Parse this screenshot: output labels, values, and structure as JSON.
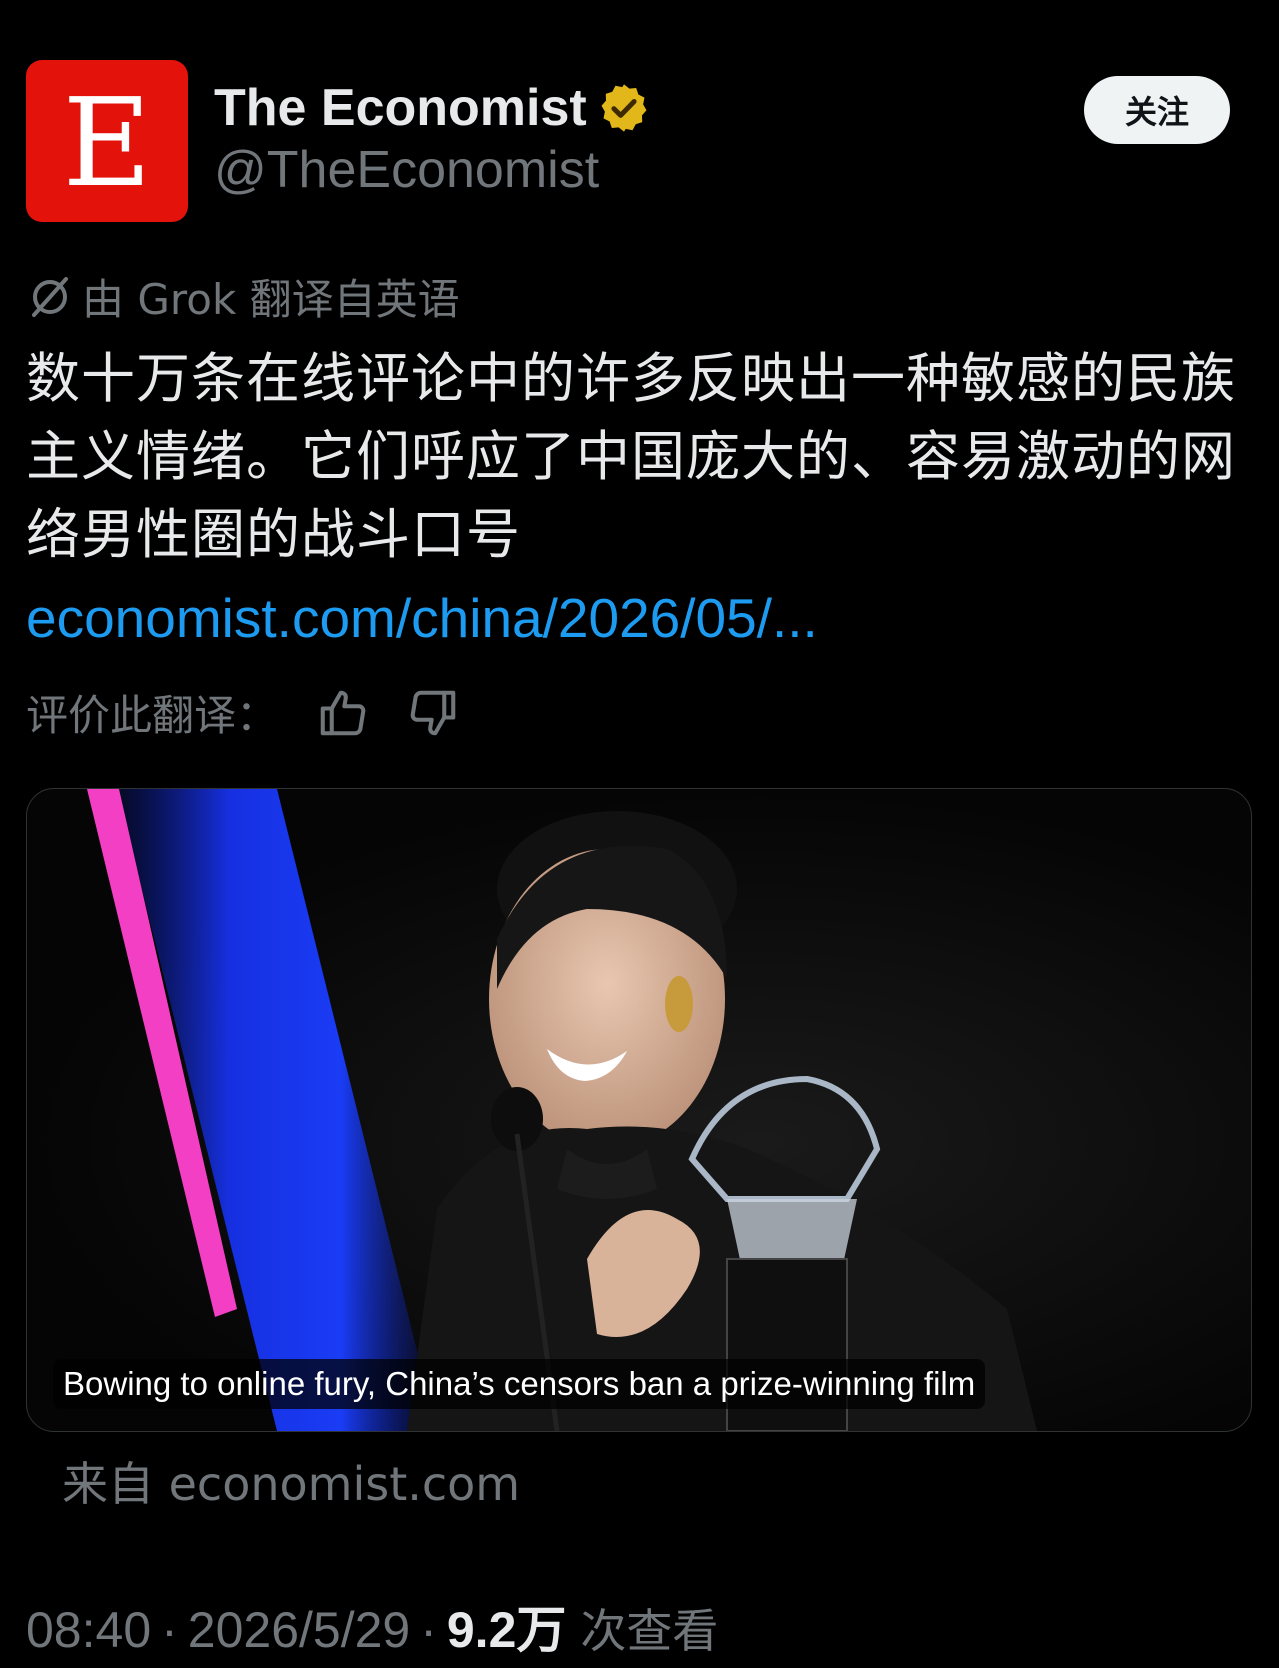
{
  "account": {
    "avatar_letter": "E",
    "avatar_color": "#e3120b",
    "name": "The Economist",
    "verified_badge": "gold-verified-badge-icon",
    "handle": "@TheEconomist",
    "follow_label": "关注"
  },
  "translation_note": {
    "icon": "grok-icon",
    "text": "由 Grok 翻译自英语"
  },
  "post": {
    "text": "数十万条在线评论中的许多反映出一种敏感的民族主义情绪。它们呼应了中国庞大的、容易激动的网络男性圈的战斗口号",
    "link": "economist.com/china/2026/05/..."
  },
  "rating": {
    "label": "评价此翻译：",
    "up_icon": "thumbs-up-icon",
    "down_icon": "thumbs-down-icon"
  },
  "media_card": {
    "caption": "Bowing to online fury, China’s censors ban a prize-winning film",
    "source": "来自 economist.com"
  },
  "meta": {
    "time": "08:40",
    "separator": "·",
    "date": "2026/5/29",
    "views": "9.2万",
    "views_label": "次查看"
  },
  "colors": {
    "background": "#000000",
    "link": "#1d9bf0",
    "muted": "#71767b",
    "text": "#e7e9ea",
    "verified": "#e2b719"
  }
}
